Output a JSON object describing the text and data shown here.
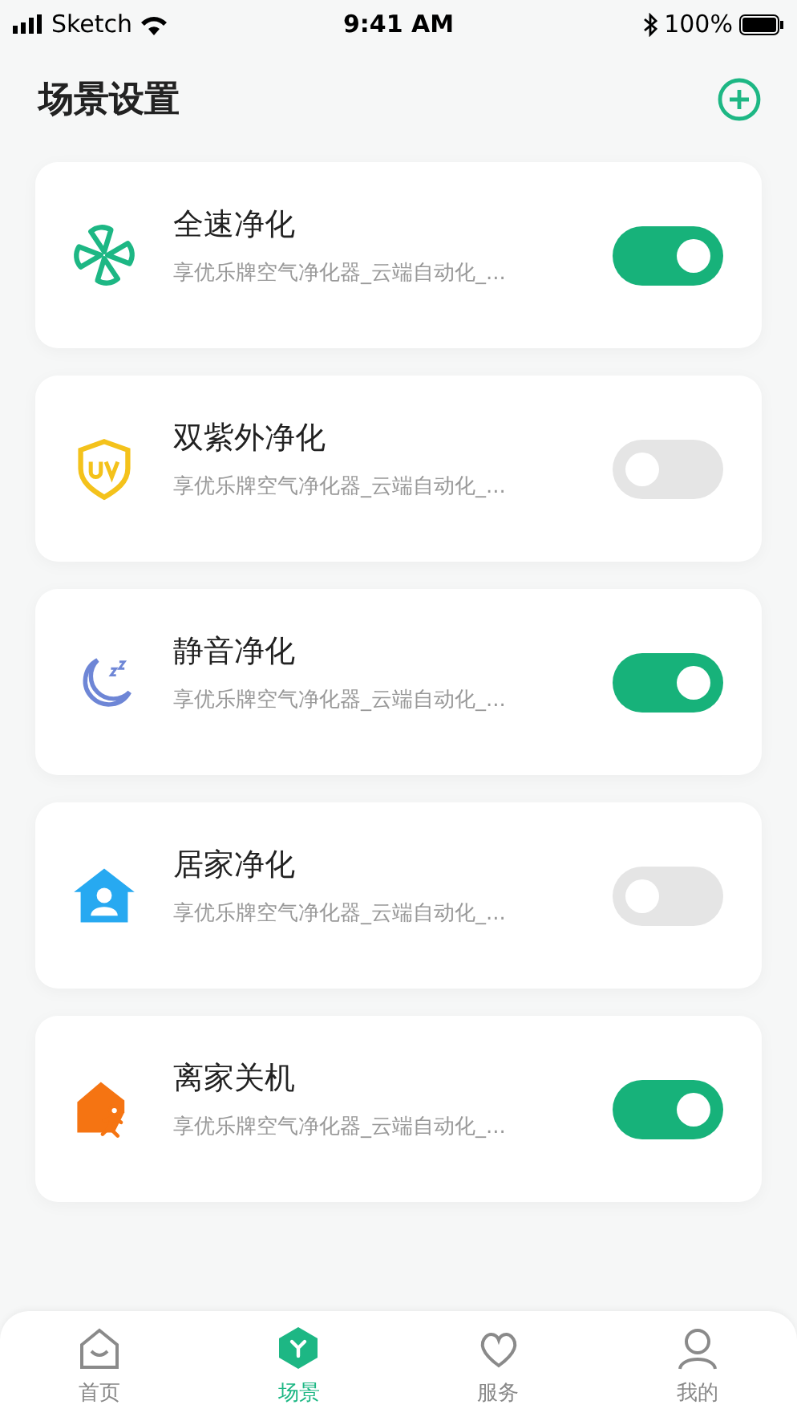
{
  "status_bar": {
    "carrier": "Sketch",
    "time": "9:41 AM",
    "battery": "100%"
  },
  "header": {
    "title": "场景设置"
  },
  "scenes": [
    {
      "kind": "fan",
      "title": "全速净化",
      "subtitle": "享优乐牌空气净化器_云端自动化_...",
      "on": true
    },
    {
      "kind": "uv",
      "title": "双紫外净化",
      "subtitle": "享优乐牌空气净化器_云端自动化_...",
      "on": false
    },
    {
      "kind": "moon",
      "title": "静音净化",
      "subtitle": "享优乐牌空气净化器_云端自动化_...",
      "on": true
    },
    {
      "kind": "home",
      "title": "居家净化",
      "subtitle": "享优乐牌空气净化器_云端自动化_...",
      "on": false
    },
    {
      "kind": "leave",
      "title": "离家关机",
      "subtitle": "享优乐牌空气净化器_云端自动化_...",
      "on": true
    }
  ],
  "tab_bar": [
    {
      "kind": "home",
      "label": "首页",
      "selected": false
    },
    {
      "kind": "scene",
      "label": "场景",
      "selected": true
    },
    {
      "kind": "service",
      "label": "服务",
      "selected": false
    },
    {
      "kind": "me",
      "label": "我的",
      "selected": false
    }
  ]
}
